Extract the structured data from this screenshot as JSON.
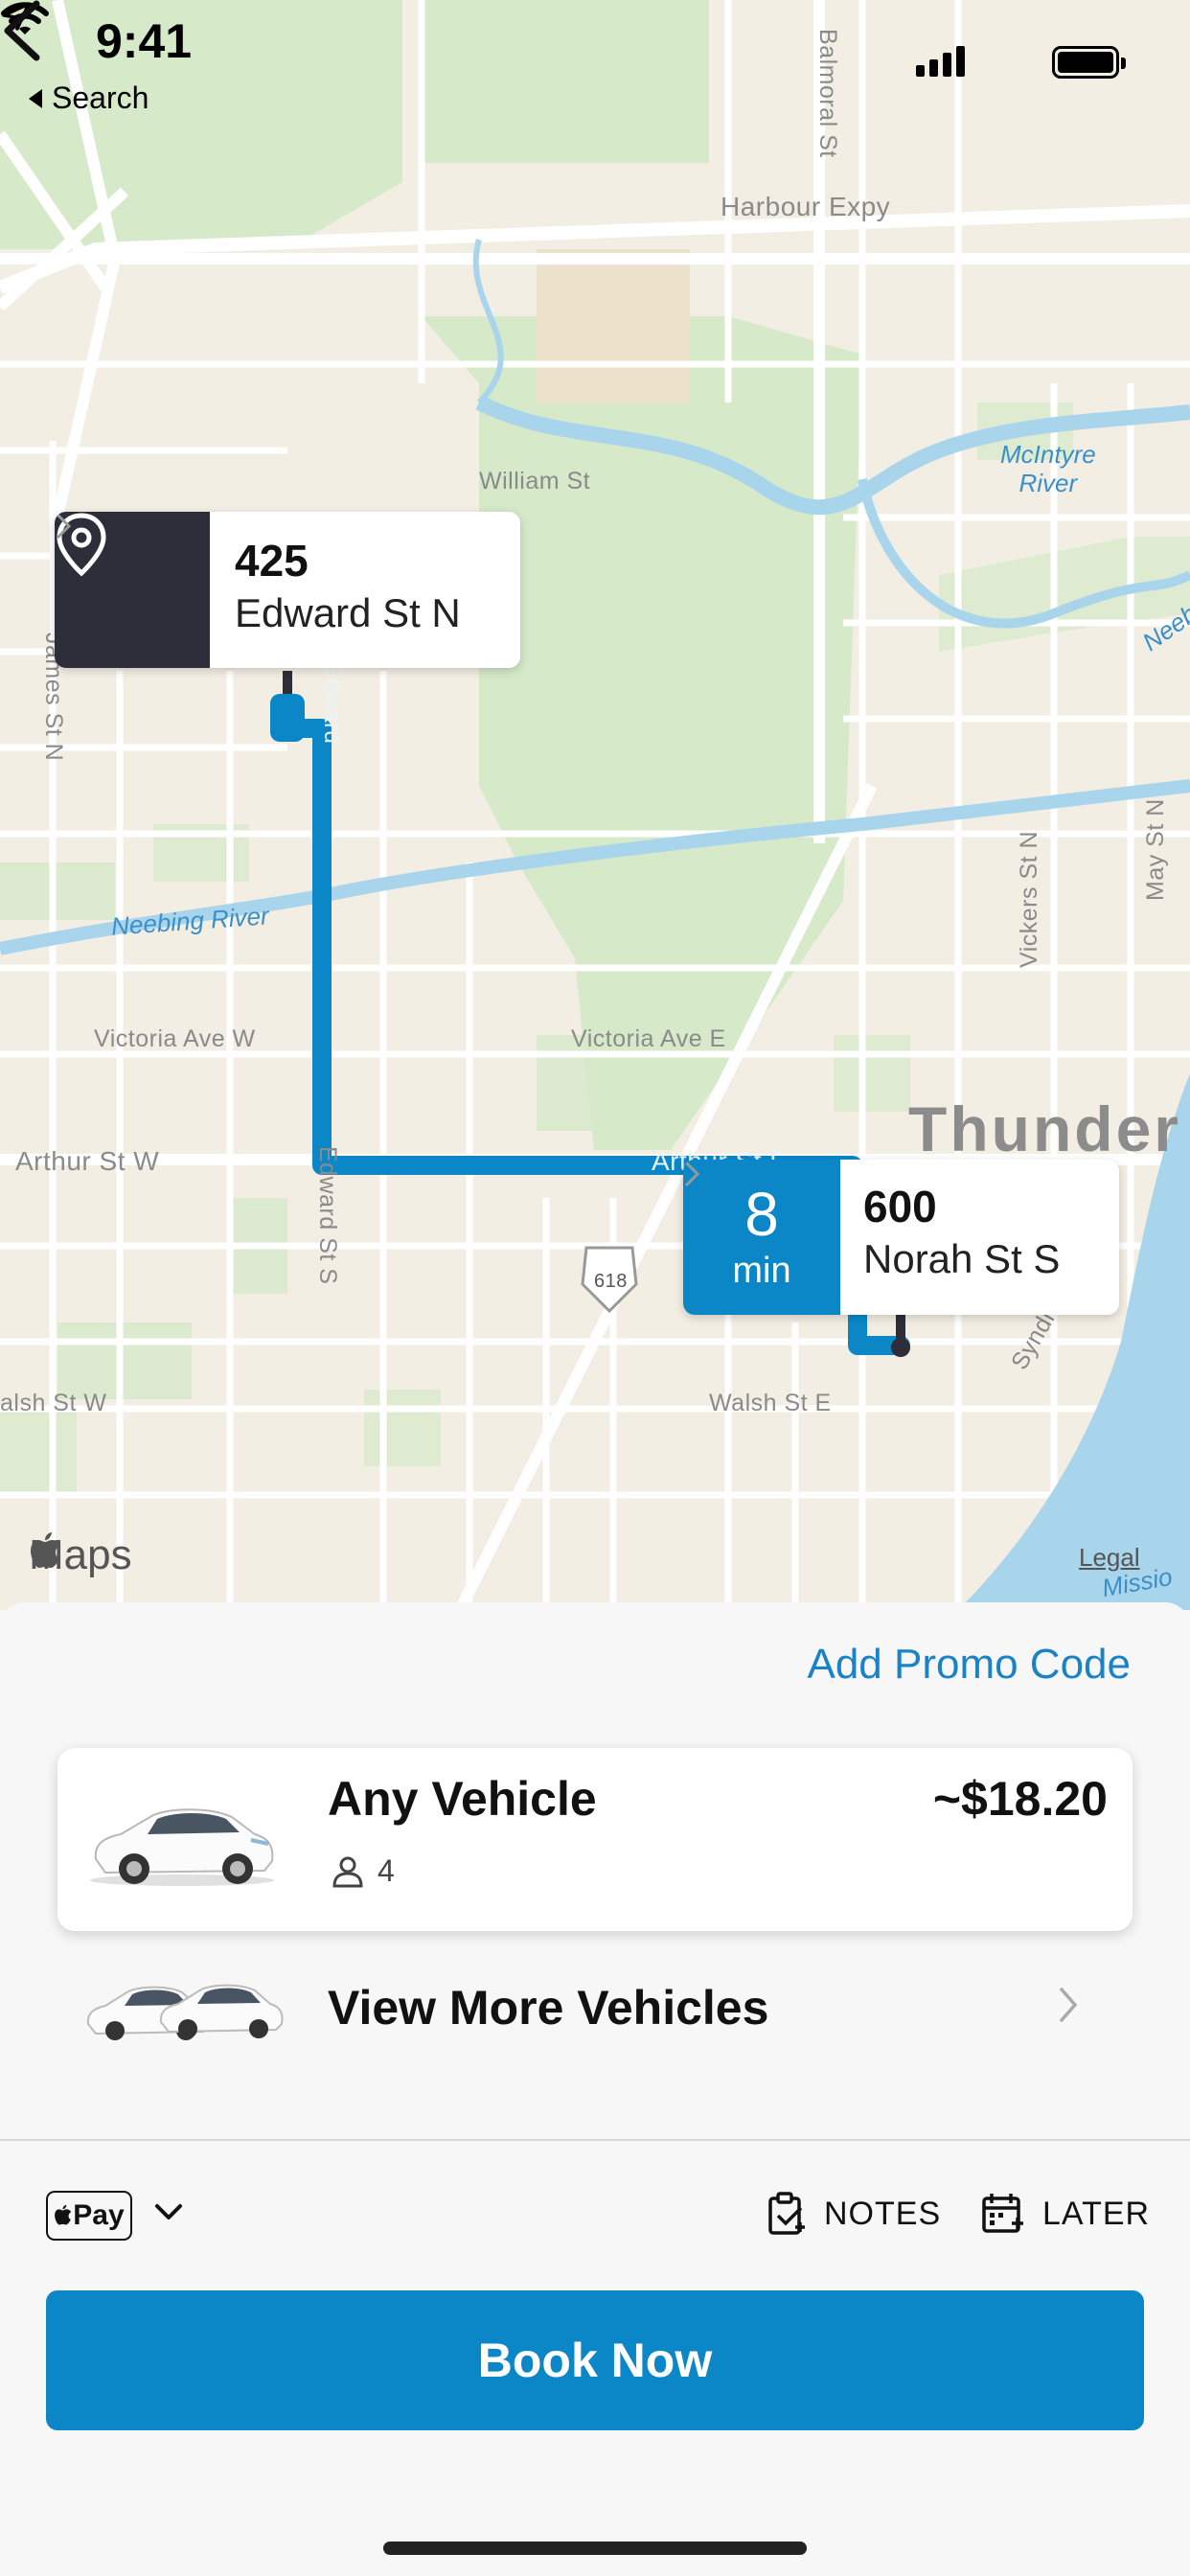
{
  "status_bar": {
    "time": "9:41",
    "back_app_label": "Search"
  },
  "map": {
    "road_labels": {
      "balmoral": "Balmoral St",
      "harbour": "Harbour Expy",
      "william": "William St",
      "james": "James St N",
      "edward_n": "Edward",
      "edward_s": "Edward St S",
      "victoria_w": "Victoria Ave W",
      "victoria_e": "Victoria Ave E",
      "arthur_w": "Arthur St W",
      "arthur_e": "Arthur St E",
      "walsh_w": "alsh St W",
      "walsh_e": "Walsh St E",
      "vickers": "Vickers St N",
      "may": "May St N",
      "syndicate": "Syndi",
      "highway": "618"
    },
    "river_labels": {
      "neebing": "Neebing River",
      "mcintyre": "McIntyre\nRiver",
      "neeb_right": "Neeb",
      "mission": "Missio"
    },
    "city_label": "Thunder",
    "pickup": {
      "number": "425",
      "street": "Edward St N"
    },
    "dropoff": {
      "number": "600",
      "street": "Norah St S",
      "eta_value": "8",
      "eta_unit": "min"
    },
    "maps_logo": "Maps",
    "legal": "Legal",
    "colors": {
      "route": "#0b87c8",
      "land": "#f3eee3",
      "park": "#d6e9c9",
      "water": "#a8d4ec"
    }
  },
  "sheet": {
    "promo_label": "Add Promo Code",
    "vehicle": {
      "name": "Any Vehicle",
      "price": "~$18.20",
      "seats": "4"
    },
    "more_vehicles_label": "View More Vehicles",
    "payment": {
      "method_label": "Pay"
    },
    "notes_label": "NOTES",
    "later_label": "LATER",
    "book_label": "Book Now"
  }
}
